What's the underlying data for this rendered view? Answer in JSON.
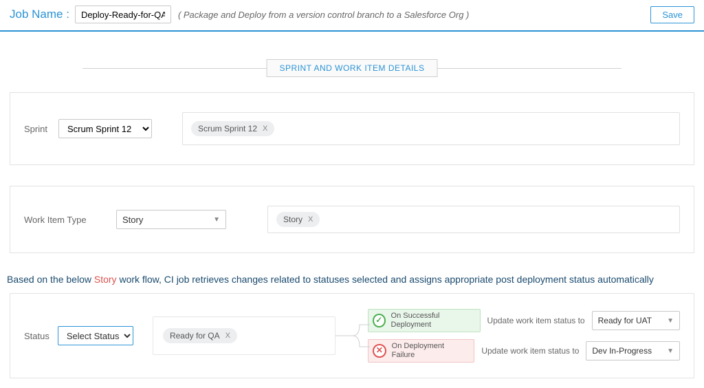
{
  "header": {
    "job_label": "Job Name :",
    "job_value": "Deploy-Ready-for-QA",
    "description": "( Package and Deploy from a version control branch to a Salesforce Org )",
    "save": "Save"
  },
  "section_title": "SPRINT AND WORK ITEM DETAILS",
  "sprint": {
    "label": "Sprint",
    "selected": "Scrum Sprint 12",
    "chip": "Scrum Sprint 12"
  },
  "work_item_type": {
    "label": "Work Item Type",
    "selected": "Story",
    "chip": "Story"
  },
  "story_note": {
    "prefix": "Based on the below ",
    "story": "Story",
    "suffix": " work flow, CI job retrieves changes related to statuses selected and assigns appropriate post deployment status automatically"
  },
  "status": {
    "label": "Status",
    "placeholder": "Select Status",
    "chip": "Ready for QA",
    "success": {
      "title": "On Successful Deployment",
      "update_label": "Update work item status to",
      "value": "Ready for UAT"
    },
    "failure": {
      "title": "On Deployment Failure",
      "update_label": "Update work item status to",
      "value": "Dev In-Progress"
    }
  }
}
